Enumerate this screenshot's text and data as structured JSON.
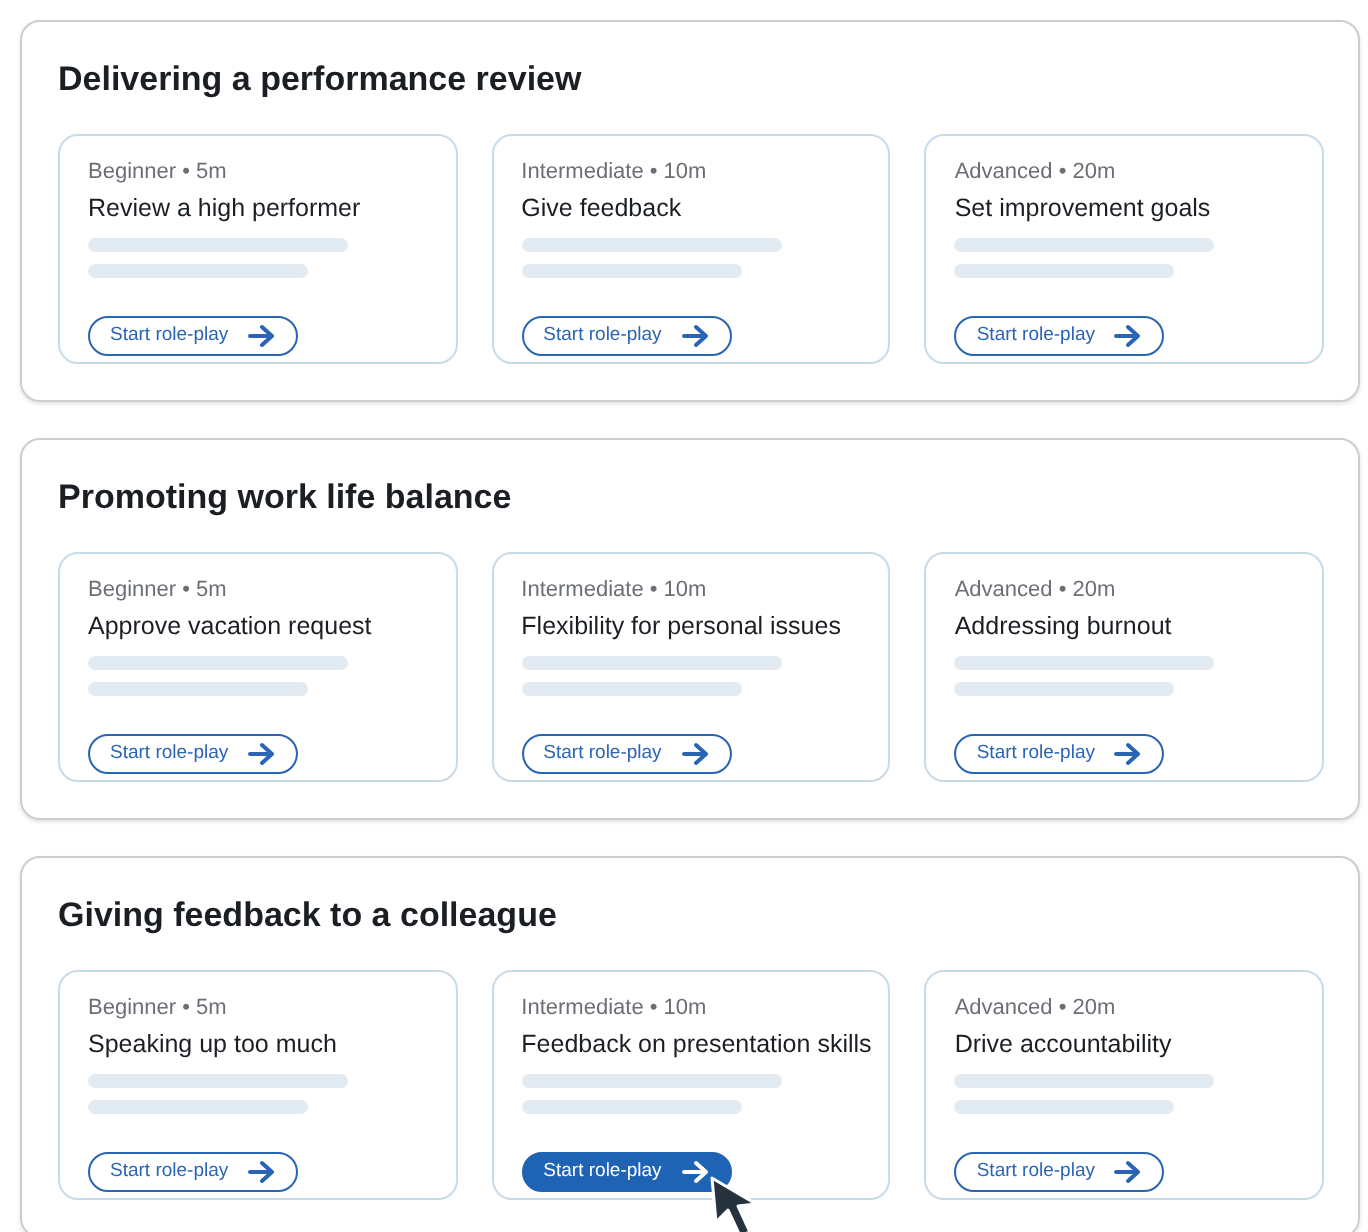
{
  "sections": [
    {
      "title": "Delivering a performance review",
      "cards": [
        {
          "meta": "Beginner • 5m",
          "title": "Review a high performer",
          "button": "Start role-play",
          "hovered": false
        },
        {
          "meta": "Intermediate • 10m",
          "title": "Give feedback",
          "button": "Start role-play",
          "hovered": false
        },
        {
          "meta": "Advanced • 20m",
          "title": "Set improvement goals",
          "button": "Start role-play",
          "hovered": false
        }
      ]
    },
    {
      "title": "Promoting work life balance",
      "cards": [
        {
          "meta": "Beginner • 5m",
          "title": "Approve vacation request",
          "button": "Start role-play",
          "hovered": false
        },
        {
          "meta": "Intermediate • 10m",
          "title": "Flexibility for personal issues",
          "button": "Start role-play",
          "hovered": false
        },
        {
          "meta": "Advanced • 20m",
          "title": "Addressing burnout",
          "button": "Start role-play",
          "hovered": false
        }
      ]
    },
    {
      "title": "Giving feedback to a colleague",
      "cards": [
        {
          "meta": "Beginner • 5m",
          "title": "Speaking up too much",
          "button": "Start role-play",
          "hovered": false
        },
        {
          "meta": "Intermediate • 10m",
          "title": "Feedback on presentation skills",
          "button": "Start role-play",
          "hovered": true
        },
        {
          "meta": "Advanced • 20m",
          "title": "Drive accountability",
          "button": "Start role-play",
          "hovered": false
        }
      ]
    }
  ]
}
